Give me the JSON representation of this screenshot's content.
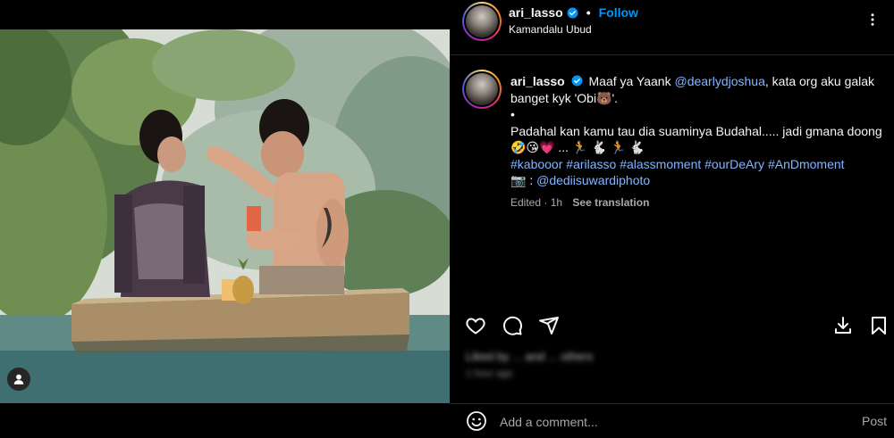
{
  "post": {
    "username": "ari_lasso",
    "follow_label": "Follow",
    "dot": "•",
    "location": "Kamandalu Ubud",
    "caption": {
      "username": "ari_lasso",
      "line1_pre": "Maaf ya Yaank ",
      "mention1": "@dearlydjoshua",
      "line1_post": ", kata org aku galak banget kyk 'Obi🐻'.",
      "bullet": "•",
      "line2": "Padahal kan kamu tau dia suaminya Budahal..... jadi gmana doong",
      "emojis": "🤣😘💗 ... 🏃 🐇 🏃 🐇",
      "hashtags": [
        "#kabooor",
        "#arilasso",
        "#alassmoment",
        "#ourDeAry",
        "#AnDmoment"
      ],
      "photo_prefix": "📷 : ",
      "mention2": "@dediisuwardiphoto"
    },
    "meta": {
      "edited": "Edited · 1h",
      "see_translation": "See translation"
    },
    "likes_text": "Liked by ... and ... others",
    "time_text": "1 hour ago"
  },
  "comment": {
    "placeholder": "Add a comment...",
    "post_label": "Post"
  },
  "icons": {
    "like": "heart-icon",
    "comment": "comment-icon",
    "share": "send-icon",
    "download": "download-icon",
    "save": "bookmark-icon",
    "emoji": "emoji-icon",
    "more": "more-icon",
    "tag": "user-tag-icon"
  },
  "colors": {
    "background": "#000000",
    "link": "#0095f6",
    "mention": "#82b4ff",
    "muted": "#a8a8a8"
  }
}
